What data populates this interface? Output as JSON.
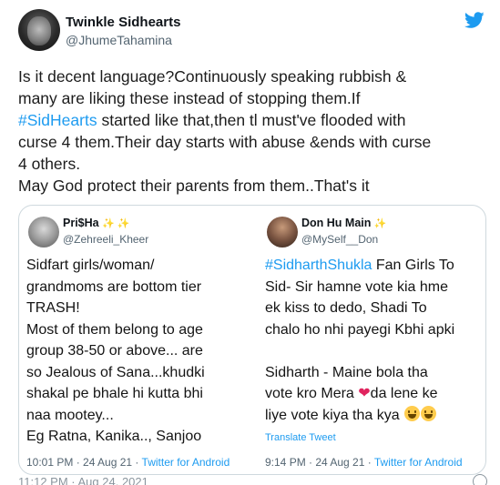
{
  "author": {
    "display_name": "Twinkle Sidhearts",
    "handle": "@JhumeTahamina"
  },
  "tweet": {
    "lines": [
      "Is it decent language?Continuously speaking rubbish &",
      "many are liking these instead of stopping them.If",
      "started like that,then tl must've flooded with",
      "curse 4 them.Their day starts with abuse &ends with curse",
      "4 others.",
      "May God protect their parents from them..That's it"
    ],
    "hashtag": "#SidHearts"
  },
  "cards": {
    "left": {
      "name": "Pri$Ha",
      "sparkle": "✨ ✨",
      "handle": "@Zehreeli_Kheer",
      "lines": [
        "Sidfart girls/woman/",
        "grandmoms are bottom tier",
        "TRASH!",
        "Most of them belong to age",
        "group 38-50 or above... are",
        "so Jealous of Sana...khudki",
        "shakal pe bhale hi kutta bhi",
        "naa mootey...",
        "Eg Ratna, Kanika.., Sanjoo"
      ],
      "time": "10:01 PM · 24 Aug 21 · ",
      "source": "Twitter for Android"
    },
    "right": {
      "name": "Don Hu Main",
      "sparkle": "✨",
      "handle": "@MySelf__Don",
      "hashtag": "#SidharthShukla",
      "line1_rest": " Fan Girls To",
      "lines": [
        "Sid- Sir hamne vote kia hme",
        "ek kiss to dedo,  Shadi To",
        "chalo ho nhi payegi Kbhi apki",
        "",
        "Sidharth - Maine bola tha"
      ],
      "line_heart_pre": "vote kro Mera ",
      "heart": "❤",
      "line_heart_post": "da lene ke",
      "last_line": "liye vote kiya tha kya ",
      "translate": "Translate Tweet",
      "time": "9:14 PM · 24 Aug 21 · ",
      "source": "Twitter for Android"
    }
  },
  "footer": {
    "timestamp": "11:12 PM · Aug 24, 2021"
  },
  "colors": {
    "accent": "#1d9bf0",
    "muted": "#536471",
    "heart": "#e0245e"
  }
}
